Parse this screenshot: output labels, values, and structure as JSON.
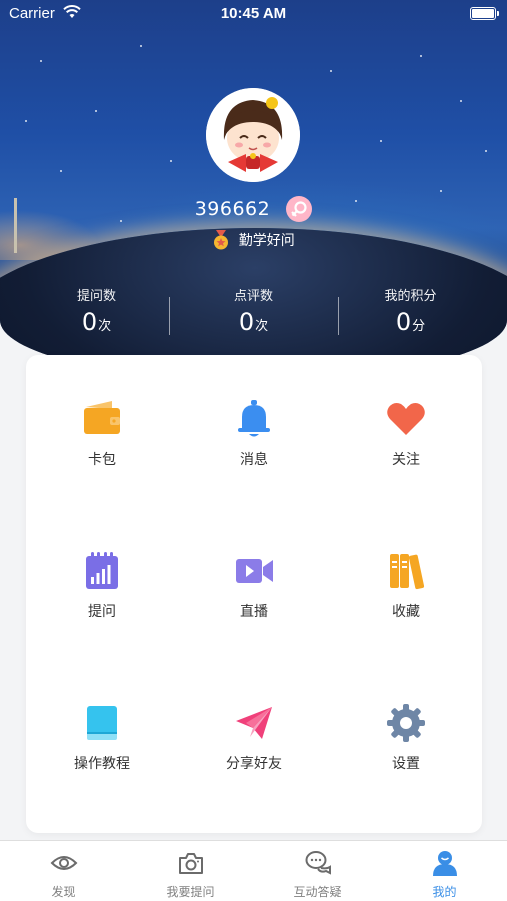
{
  "status_bar": {
    "carrier": "Carrier",
    "time": "10:45 AM"
  },
  "profile": {
    "user_id": "396662",
    "title": "勤学好问"
  },
  "stats": [
    {
      "label": "提问数",
      "value": "0",
      "unit": "次"
    },
    {
      "label": "点评数",
      "value": "0",
      "unit": "次"
    },
    {
      "label": "我的积分",
      "value": "0",
      "unit": "分"
    }
  ],
  "menu": [
    {
      "label": "卡包",
      "icon": "wallet-icon",
      "color": "#f5a623"
    },
    {
      "label": "消息",
      "icon": "bell-icon",
      "color": "#3b8ef0"
    },
    {
      "label": "关注",
      "icon": "heart-icon",
      "color": "#f2664a"
    },
    {
      "label": "提问",
      "icon": "chart-notebook-icon",
      "color": "#7a6ee6"
    },
    {
      "label": "直播",
      "icon": "video-camera-icon",
      "color": "#8b7ce8"
    },
    {
      "label": "收藏",
      "icon": "books-icon",
      "color": "#f5a623"
    },
    {
      "label": "操作教程",
      "icon": "book-icon",
      "color": "#35c3ee"
    },
    {
      "label": "分享好友",
      "icon": "paper-plane-icon",
      "color": "#f0407a"
    },
    {
      "label": "设置",
      "icon": "gear-icon",
      "color": "#6e86a6"
    }
  ],
  "tabs": [
    {
      "label": "发现",
      "icon": "eye-icon",
      "active": false
    },
    {
      "label": "我要提问",
      "icon": "camera-icon",
      "active": false
    },
    {
      "label": "互动答疑",
      "icon": "chat-bubbles-icon",
      "active": false
    },
    {
      "label": "我的",
      "icon": "user-icon",
      "active": true
    }
  ],
  "colors": {
    "accent": "#3a8ee6",
    "tab_inactive": "#808080"
  }
}
